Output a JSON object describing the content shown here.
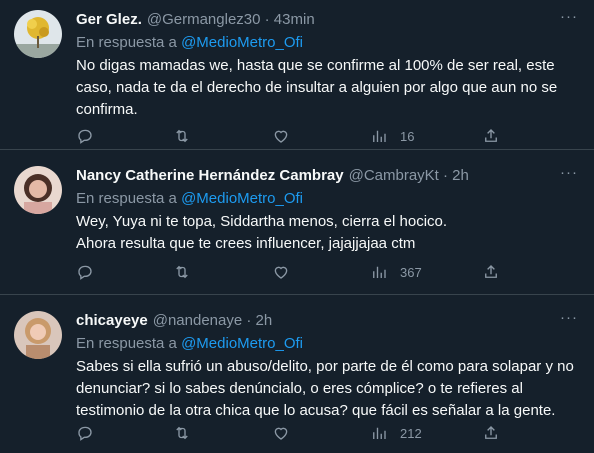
{
  "reply_prefix": "En respuesta a",
  "tweets": [
    {
      "name": "Ger Glez.",
      "handle": "@Germanglez30 · 43min",
      "reply_to": "@MedioMetro_Ofi",
      "text": "No digas mamadas we, hasta que  se confirme al 100% de ser real, este caso, nada te da el derecho de insultar a alguien  por algo que aun no se confirma.",
      "views": "16"
    },
    {
      "name": "Nancy Catherine Hernández Cambray",
      "handle": "@CambrayKt · 2h",
      "reply_to": "@MedioMetro_Ofi",
      "text": "Wey, Yuya ni te topa, Siddartha menos, cierra el hocico.\nAhora resulta que te crees influencer, jajajjajaa ctm",
      "views": "367"
    },
    {
      "name": "chicayeye",
      "handle": "@nandenaye · 2h",
      "reply_to": "@MedioMetro_Ofi",
      "text": "Sabes si ella sufrió un abuso/delito, por parte de él como para solapar y no denunciar? si lo sabes denúncialo, o eres cómplice?  o te refieres al testimonio de la otra chica que lo acusa? que fácil es señalar a la gente.",
      "views": "212"
    }
  ],
  "icons": {
    "reply": "reply-icon",
    "retweet": "retweet-icon",
    "like": "like-icon",
    "views": "views-icon",
    "share": "share-icon",
    "more": "more-icon"
  },
  "colors": {
    "background": "#15202b",
    "border": "#38444d",
    "text": "#f7f9f9",
    "secondary": "#8b98a5",
    "accent": "#1d9bf0"
  }
}
